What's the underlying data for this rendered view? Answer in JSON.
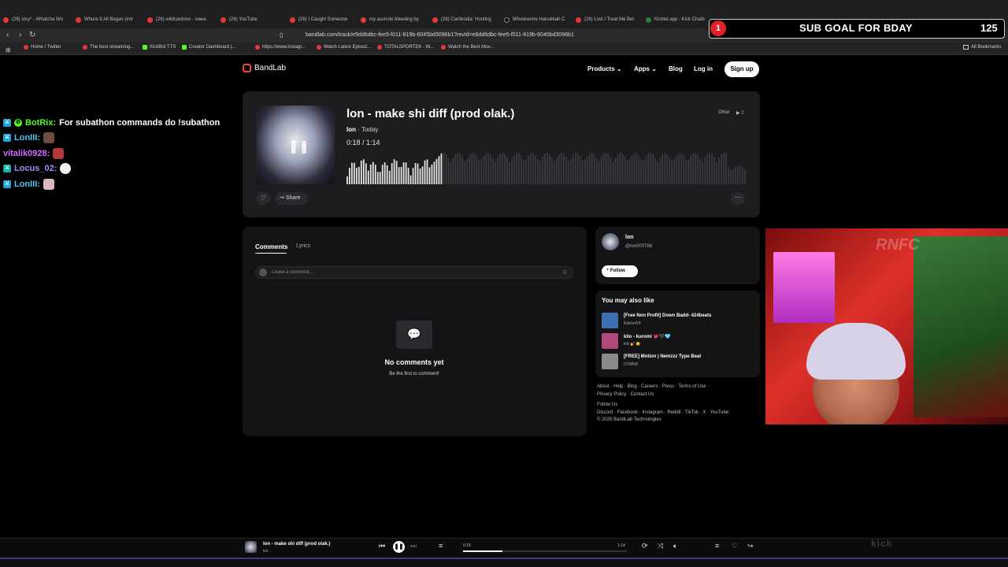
{
  "browser": {
    "tabs": [
      {
        "label": "(26) stsy* - Whatcha Wo",
        "type": "yt"
      },
      {
        "label": "Where It All Began (Intr",
        "type": "yt"
      },
      {
        "label": "(26) wildcarduno - swea",
        "type": "yt"
      },
      {
        "label": "(26) YouTube",
        "type": "yt"
      },
      {
        "label": "(26) I Caught Someone",
        "type": "yt"
      },
      {
        "label": "my asshole bleeding by",
        "type": "yt"
      },
      {
        "label": "(26) Cambodia: Hunting",
        "type": "yt"
      },
      {
        "label": "Wholesome Hanukkah C",
        "type": "tt"
      },
      {
        "label": "(26) Lost / Treat Me Bet",
        "type": "yt"
      },
      {
        "label": "Kicklet.app - Kick Chatb",
        "type": "k"
      }
    ],
    "url": "bandlab.com/track/e9dd6dbc-fee5-f011-819b-6045bd3096b1?revId=e8dd6dbc-fee5-f011-819b-6045bd3096b1",
    "bookmarks": [
      {
        "label": "Home / Twitter",
        "icon": "x-icon"
      },
      {
        "label": "The best streaming...",
        "icon": "diamond-icon"
      },
      {
        "label": "KickBot TTS",
        "icon": "kick-icon"
      },
      {
        "label": "Creator Dashboard |...",
        "icon": "kick-icon"
      },
      {
        "label": "https://www.instagr...",
        "icon": "instagram-icon"
      },
      {
        "label": "Watch Latest Episod...",
        "icon": "play-icon"
      },
      {
        "label": "TOTALSPORTEK - W...",
        "icon": "tsp-icon"
      },
      {
        "label": "Watch the Best Mov...",
        "icon": "play-icon"
      }
    ],
    "all_bookmarks": "All Bookmarks"
  },
  "overlay": {
    "goal_number": "1",
    "goal_text": "SUB GOAL FOR BDAY",
    "goal_count": "125",
    "chat": [
      {
        "user": "BotRix:",
        "user_color": "#53fc18",
        "message": "For subathon commands do !subathon",
        "badges": [
          "mod",
          "gear"
        ]
      },
      {
        "user": "LonIII:",
        "user_color": "#4fc3f7",
        "message": "",
        "badges": [
          "mod"
        ],
        "emote": "brown"
      },
      {
        "user": "vitalik0928:",
        "user_color": "#d46bff",
        "message": "",
        "badges": [],
        "emote": "red"
      },
      {
        "user": "Locus_02:",
        "user_color": "#a78bfa",
        "message": "",
        "badges": [
          "teal"
        ],
        "emote": "white"
      },
      {
        "user": "LonIII:",
        "user_color": "#4fc3f7",
        "message": "",
        "badges": [
          "mod"
        ],
        "emote": "pink"
      }
    ],
    "webcam_logo": "RNFC",
    "kick_logo": "kick"
  },
  "bandlab": {
    "logo": "BandLab",
    "nav": {
      "products": "Products",
      "apps": "Apps",
      "blog": "Blog",
      "login": "Log in",
      "signup": "Sign up"
    },
    "track": {
      "title": "lon - make shi diff (prod olak.)",
      "artist": "lon",
      "date": "Today",
      "current_time": "0:18",
      "duration": "1:14",
      "progress": 0.24,
      "genre": "Other",
      "plays": "2",
      "share": "Share"
    },
    "comments": {
      "tab_comments": "Comments",
      "tab_lyrics": "Lyrics",
      "placeholder": "Leave a comment...",
      "empty_title": "No comments yet",
      "empty_sub": "Be the first to comment!"
    },
    "artist": {
      "name": "lon",
      "handle": "@lon000788",
      "follow": "Follow"
    },
    "suggestions": {
      "title": "You may also like",
      "items": [
        {
          "name": "[Free Non Profit] Down Badd- 424beats",
          "user": "Kobra424",
          "color": "#3d6fb3"
        },
        {
          "name": "kilo - kuromi 💗🖤🩵",
          "user": "kilo 💅🌟",
          "color": "#b0487a"
        },
        {
          "name": "[FREE] Motion | Nemzzz Type Beat",
          "user": "DYMND",
          "color": "#8a8a8a"
        }
      ]
    },
    "footer": {
      "line1": "About · Help · Blog · Careers · Press · Terms of Use ·",
      "line2": "Privacy Policy · Contact Us",
      "follow_us": "Follow Us",
      "social": "Discord · Facebook · Instagram · Reddit · TikTok · X · YouTube",
      "copyright": "© 2025 BandLab Technologies"
    },
    "player": {
      "title": "lon - make shi diff (prod olak.)",
      "artist": "lon",
      "current_time": "0:18",
      "duration": "1:14",
      "progress": 0.24
    }
  },
  "colors": {
    "accent": "#f0473c",
    "played_wave": "#e6e6e6",
    "unplayed_wave": "#3a3a3e"
  }
}
